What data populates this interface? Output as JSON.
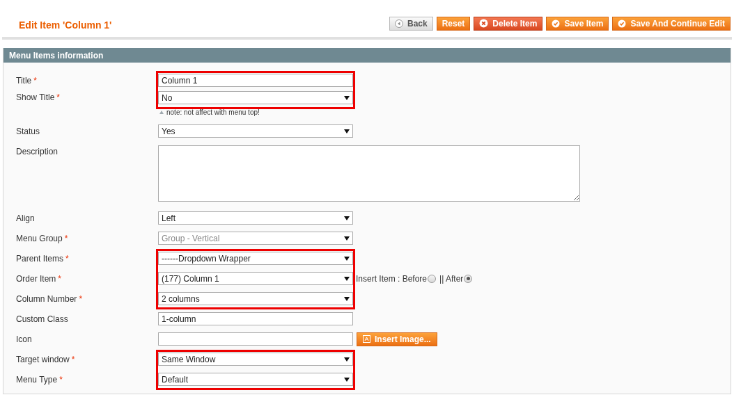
{
  "page_title": "Edit Item 'Column 1'",
  "buttons": [
    {
      "label": "Back",
      "kind": "back"
    },
    {
      "label": "Reset",
      "kind": "plain"
    },
    {
      "label": "Delete Item",
      "kind": "delete"
    },
    {
      "label": "Save Item",
      "kind": "save"
    },
    {
      "label": "Save And Continue Edit",
      "kind": "save"
    }
  ],
  "section": {
    "title": "Menu Items information",
    "groups": [
      {
        "highlighted": true,
        "fields": [
          {
            "label": "Title",
            "required_mark": "*",
            "kind": "text",
            "value": "Column 1"
          },
          {
            "label": "Show Title",
            "required_mark": "*",
            "kind": "select",
            "value": "No",
            "note": "note: not affect with menu top!"
          }
        ]
      },
      {
        "highlighted": false,
        "fields": [
          {
            "label": "Status",
            "kind": "select",
            "value": "Yes"
          },
          {
            "label": "Description",
            "kind": "textarea"
          },
          {
            "label": "Align",
            "kind": "select",
            "value": "Left"
          },
          {
            "label": "Menu Group",
            "required_mark": "*",
            "kind": "select",
            "value": "Group - Vertical",
            "disabled": true
          }
        ]
      },
      {
        "highlighted": true,
        "fields": [
          {
            "label": "Parent Items",
            "required_mark": "*",
            "kind": "select",
            "value": "------Dropdown Wrapper"
          },
          {
            "label": "Order Item",
            "required_mark": "*",
            "kind": "select",
            "value": "(177) Column 1",
            "radios": [
              {
                "label": "Insert Item : Before",
                "selected": false
              },
              {
                "label": "|| After",
                "selected": true
              }
            ]
          },
          {
            "label": "Column Number",
            "required_mark": "*",
            "kind": "select",
            "value": "2 columns"
          }
        ]
      },
      {
        "highlighted": false,
        "fields": [
          {
            "label": "Custom Class",
            "kind": "text",
            "value": "1-column"
          },
          {
            "label": "Icon",
            "kind": "text",
            "button": "Insert Image..."
          }
        ]
      },
      {
        "highlighted": true,
        "fields": [
          {
            "label": "Target window",
            "required_mark": "*",
            "kind": "select",
            "value": "Same Window"
          },
          {
            "label": "Menu Type",
            "required_mark": "*",
            "kind": "select",
            "value": "Default"
          }
        ]
      }
    ]
  }
}
